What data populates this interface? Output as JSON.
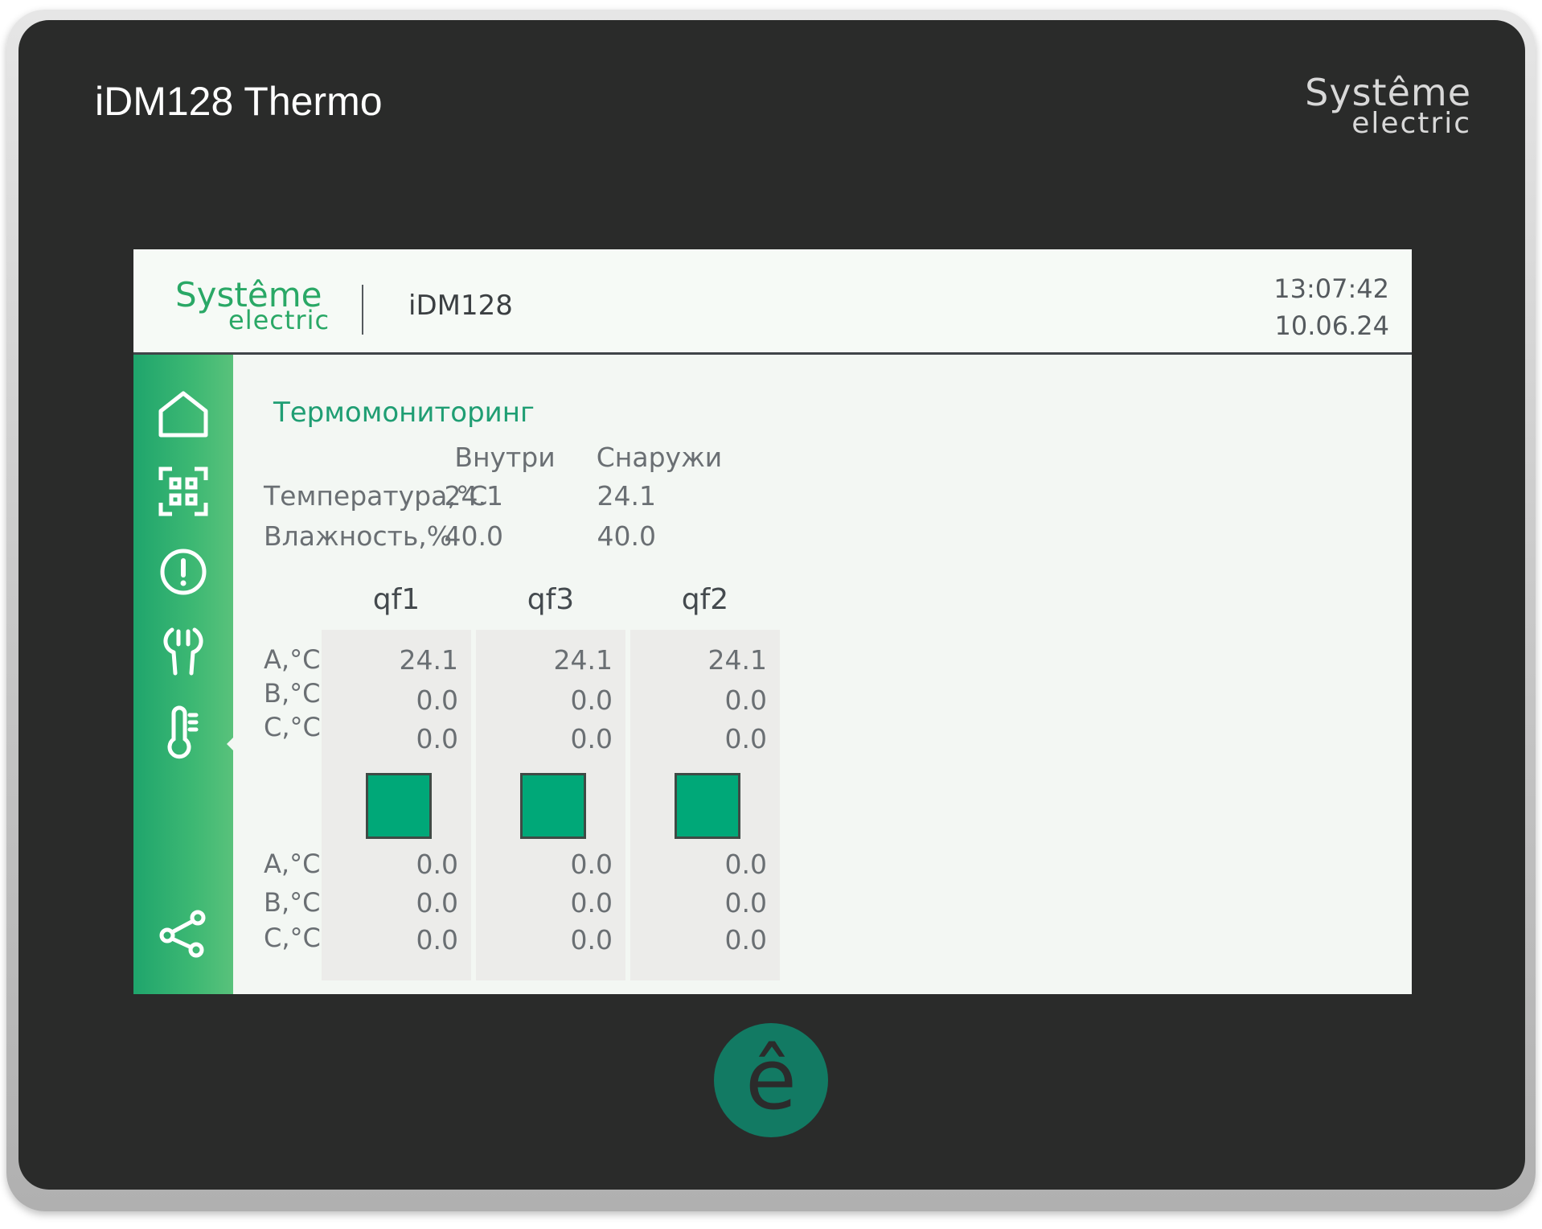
{
  "device": {
    "title": "iDM128 Thermo",
    "brand_line1": "Systême",
    "brand_line2": "electric",
    "home_glyph": "ê"
  },
  "header": {
    "brand_line1": "Systême",
    "brand_line2": "electric",
    "device_name": "iDM128",
    "time": "13:07:42",
    "date": "10.06.24"
  },
  "sidebar": {
    "items": [
      {
        "icon": "home-icon"
      },
      {
        "icon": "qr-scan-icon"
      },
      {
        "icon": "alert-icon"
      },
      {
        "icon": "tools-icon"
      },
      {
        "icon": "thermometer-icon"
      },
      {
        "icon": "share-icon"
      }
    ],
    "active_index": 4
  },
  "main": {
    "title": "Термомониторинг",
    "ambient": {
      "columns": [
        "Внутри",
        "Снаружи"
      ],
      "rows": [
        {
          "label": "Температура,°C",
          "values": [
            "24.1",
            "24.1"
          ]
        },
        {
          "label": "Влажность,%",
          "values": [
            "40.0",
            "40.0"
          ]
        }
      ]
    },
    "breakers": {
      "names": [
        "qf1",
        "qf3",
        "qf2"
      ],
      "upper_labels": [
        "A,°C",
        "B,°C",
        "C,°C"
      ],
      "upper_values": [
        [
          "24.1",
          "0.0",
          "0.0"
        ],
        [
          "24.1",
          "0.0",
          "0.0"
        ],
        [
          "24.1",
          "0.0",
          "0.0"
        ]
      ],
      "lower_labels": [
        "A,°C",
        "B,°C",
        "C,°C"
      ],
      "lower_values": [
        [
          "0.0",
          "0.0",
          "0.0"
        ],
        [
          "0.0",
          "0.0",
          "0.0"
        ],
        [
          "0.0",
          "0.0",
          "0.0"
        ]
      ],
      "status_color": "#00a878"
    }
  },
  "colors": {
    "accent": "#2aa866",
    "bezel": "#2a2b2a",
    "screen_bg": "#f3f7f3",
    "sidebar": "#3db873"
  }
}
